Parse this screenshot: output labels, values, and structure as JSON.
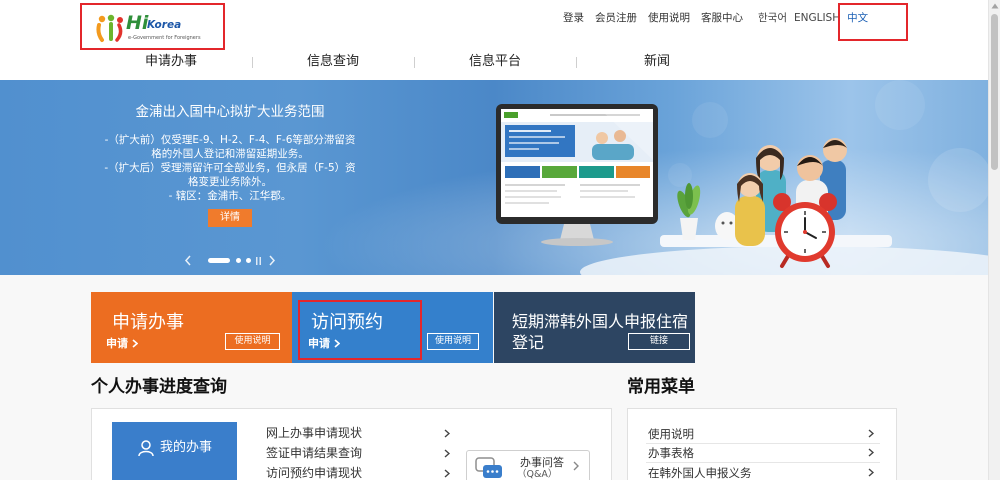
{
  "header": {
    "logo": {
      "brand_hi": "Hi",
      "brand_korea": "Korea",
      "tagline": "e-Government for Foreigners",
      "icon": "hikorea-figures-icon"
    },
    "top_links": [
      {
        "label": "登录"
      },
      {
        "label": "会员注册"
      },
      {
        "label": "使用说明"
      },
      {
        "label": "客服中心"
      }
    ],
    "languages": [
      {
        "label": "한국어",
        "active": false
      },
      {
        "label": "ENGLISH",
        "active": false
      },
      {
        "label": "中文",
        "active": true
      }
    ]
  },
  "nav": {
    "items": [
      {
        "label": "申请办事"
      },
      {
        "label": "信息查询"
      },
      {
        "label": "信息平台"
      },
      {
        "label": "新闻"
      }
    ]
  },
  "banner": {
    "title": "金浦出入国中心拟扩大业务范围",
    "paragraphs": [
      "-（扩大前）仅受理E-9、H-2、F-4、F-6等部分滞留资格的外国人登记和滞留延期业务。",
      "-（扩大后）受理滞留许可全部业务，但永居（F-5）资格变更业务除外。",
      "- 辖区：金浦市、江华郡。"
    ],
    "detail_button": "详情",
    "slides_total": 3,
    "active_slide": 1,
    "controls": {
      "prev_icon": "chevron-left-icon",
      "pause_icon": "pause-icon",
      "next_icon": "chevron-right-icon"
    }
  },
  "service_cards": [
    {
      "title": "申请办事",
      "action": "申请",
      "guide_button": "使用说明",
      "color": "#ec6d21"
    },
    {
      "title": "访问预约",
      "action": "申请",
      "guide_button": "使用说明",
      "color": "#3480cc"
    },
    {
      "title": "短期滞韩外国人申报住宿登记",
      "guide_button": "链接",
      "color": "#2d4562"
    }
  ],
  "progress_section": {
    "heading": "个人办事进度查询",
    "my_work": {
      "label": "我的办事",
      "icon": "person-icon",
      "color": "#3a7ecb"
    },
    "links": [
      "网上办事申请现状",
      "签证申请结果查询",
      "访问预约申请现状"
    ],
    "qa": {
      "label": "办事问答",
      "sub": "（Q&A）",
      "icon": "chat-bubbles-icon"
    }
  },
  "common_menu": {
    "heading": "常用菜单",
    "items": [
      "使用说明",
      "办事表格",
      "在韩外国人申报义务"
    ]
  },
  "colors": {
    "active_language": "#1a5fb4",
    "detail_button": "#f07b2c",
    "annotation_box": "#e3262b"
  }
}
